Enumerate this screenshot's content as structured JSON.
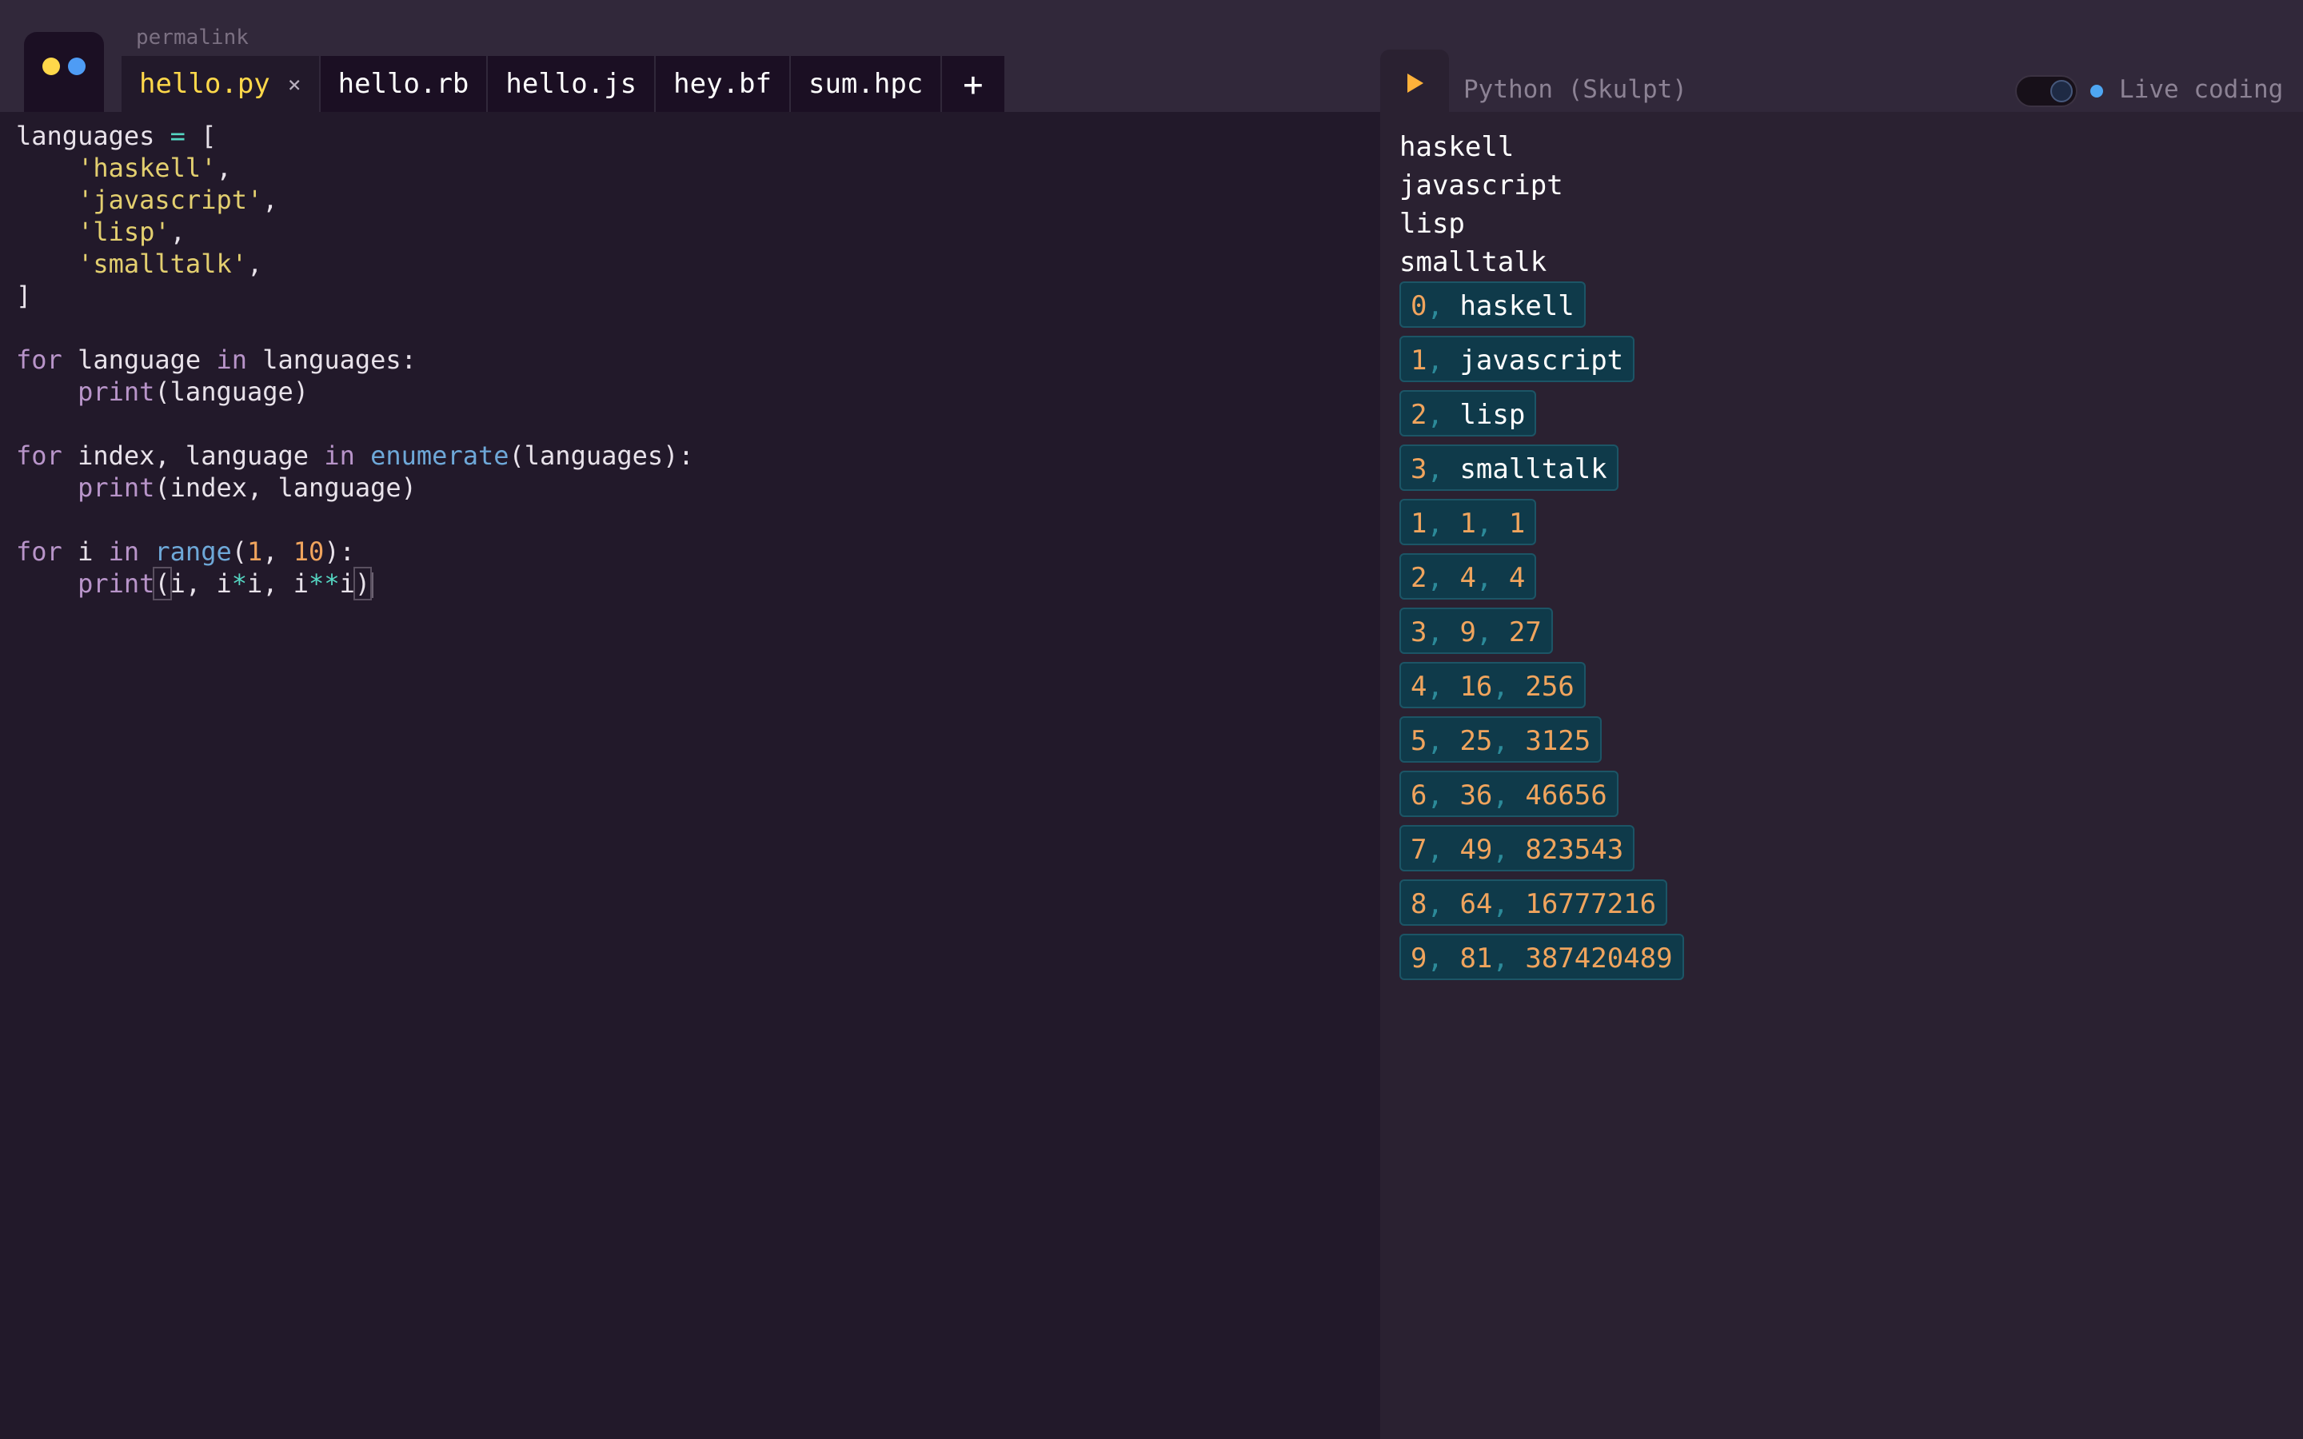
{
  "app": {
    "permalink": "permalink",
    "tabs": [
      {
        "label": "hello.py",
        "active": true,
        "close_icon": "×"
      },
      {
        "label": "hello.rb",
        "active": false
      },
      {
        "label": "hello.js",
        "active": false
      },
      {
        "label": "hey.bf",
        "active": false
      },
      {
        "label": "sum.hpc",
        "active": false
      }
    ],
    "add_tab_label": "+",
    "colors": {
      "accent_yellow": "#ffd84a",
      "accent_blue": "#4e9cf5",
      "run_orange": "#ffb23a"
    }
  },
  "editor": {
    "lines": [
      {
        "tokens": [
          {
            "t": "languages "
          },
          {
            "t": "=",
            "c": "op"
          },
          {
            "t": " ["
          }
        ]
      },
      {
        "tokens": [
          {
            "t": "    "
          },
          {
            "t": "'haskell'",
            "c": "str"
          },
          {
            "t": ","
          }
        ]
      },
      {
        "tokens": [
          {
            "t": "    "
          },
          {
            "t": "'javascript'",
            "c": "str"
          },
          {
            "t": ","
          }
        ]
      },
      {
        "tokens": [
          {
            "t": "    "
          },
          {
            "t": "'lisp'",
            "c": "str"
          },
          {
            "t": ","
          }
        ]
      },
      {
        "tokens": [
          {
            "t": "    "
          },
          {
            "t": "'smalltalk'",
            "c": "str"
          },
          {
            "t": ","
          }
        ]
      },
      {
        "tokens": [
          {
            "t": "]"
          }
        ]
      },
      {
        "tokens": []
      },
      {
        "tokens": [
          {
            "t": "for",
            "c": "kw"
          },
          {
            "t": " language "
          },
          {
            "t": "in",
            "c": "kw"
          },
          {
            "t": " languages:"
          }
        ]
      },
      {
        "tokens": [
          {
            "t": "    "
          },
          {
            "t": "print",
            "c": "kw"
          },
          {
            "t": "(language)"
          }
        ]
      },
      {
        "tokens": []
      },
      {
        "tokens": [
          {
            "t": "for",
            "c": "kw"
          },
          {
            "t": " index, language "
          },
          {
            "t": "in",
            "c": "kw"
          },
          {
            "t": " "
          },
          {
            "t": "enumerate",
            "c": "fn"
          },
          {
            "t": "(languages):"
          }
        ]
      },
      {
        "tokens": [
          {
            "t": "    "
          },
          {
            "t": "print",
            "c": "kw"
          },
          {
            "t": "(index, language)"
          }
        ]
      },
      {
        "tokens": []
      },
      {
        "tokens": [
          {
            "t": "for",
            "c": "kw"
          },
          {
            "t": " i "
          },
          {
            "t": "in",
            "c": "kw"
          },
          {
            "t": " "
          },
          {
            "t": "range",
            "c": "fn"
          },
          {
            "t": "("
          },
          {
            "t": "1",
            "c": "num"
          },
          {
            "t": ", "
          },
          {
            "t": "10",
            "c": "num"
          },
          {
            "t": "):"
          }
        ]
      },
      {
        "tokens": [
          {
            "t": "    "
          },
          {
            "t": "print",
            "c": "kw"
          },
          {
            "t": "(",
            "c": "bracket"
          },
          {
            "t": "i, i"
          },
          {
            "t": "*",
            "c": "op"
          },
          {
            "t": "i, i"
          },
          {
            "t": "**",
            "c": "op"
          },
          {
            "t": "i"
          },
          {
            "t": ")",
            "c": "bracket"
          }
        ],
        "cursor": true
      }
    ]
  },
  "output_panel": {
    "run_icon": "play-icon",
    "language_label": "Python (Skulpt)",
    "live_coding_label": "Live coding",
    "live_coding_enabled": true,
    "plain_lines": [
      "haskell",
      "javascript",
      "lisp",
      "smalltalk"
    ],
    "tuple_lines": [
      [
        {
          "v": "0",
          "k": "n"
        },
        {
          "v": "haskell",
          "k": "s"
        }
      ],
      [
        {
          "v": "1",
          "k": "n"
        },
        {
          "v": "javascript",
          "k": "s"
        }
      ],
      [
        {
          "v": "2",
          "k": "n"
        },
        {
          "v": "lisp",
          "k": "s"
        }
      ],
      [
        {
          "v": "3",
          "k": "n"
        },
        {
          "v": "smalltalk",
          "k": "s"
        }
      ],
      [
        {
          "v": "1",
          "k": "n"
        },
        {
          "v": "1",
          "k": "n"
        },
        {
          "v": "1",
          "k": "n"
        }
      ],
      [
        {
          "v": "2",
          "k": "n"
        },
        {
          "v": "4",
          "k": "n"
        },
        {
          "v": "4",
          "k": "n"
        }
      ],
      [
        {
          "v": "3",
          "k": "n"
        },
        {
          "v": "9",
          "k": "n"
        },
        {
          "v": "27",
          "k": "n"
        }
      ],
      [
        {
          "v": "4",
          "k": "n"
        },
        {
          "v": "16",
          "k": "n"
        },
        {
          "v": "256",
          "k": "n"
        }
      ],
      [
        {
          "v": "5",
          "k": "n"
        },
        {
          "v": "25",
          "k": "n"
        },
        {
          "v": "3125",
          "k": "n"
        }
      ],
      [
        {
          "v": "6",
          "k": "n"
        },
        {
          "v": "36",
          "k": "n"
        },
        {
          "v": "46656",
          "k": "n"
        }
      ],
      [
        {
          "v": "7",
          "k": "n"
        },
        {
          "v": "49",
          "k": "n"
        },
        {
          "v": "823543",
          "k": "n"
        }
      ],
      [
        {
          "v": "8",
          "k": "n"
        },
        {
          "v": "64",
          "k": "n"
        },
        {
          "v": "16777216",
          "k": "n"
        }
      ],
      [
        {
          "v": "9",
          "k": "n"
        },
        {
          "v": "81",
          "k": "n"
        },
        {
          "v": "387420489",
          "k": "n"
        }
      ]
    ]
  }
}
